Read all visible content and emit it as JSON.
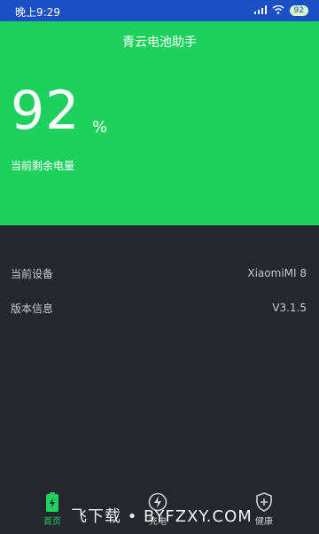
{
  "status_bar": {
    "time": "晚上9:29",
    "battery": "92"
  },
  "app": {
    "title": "青云电池助手"
  },
  "battery": {
    "level": "92",
    "unit": "%",
    "label": "当前剩余电量"
  },
  "info": [
    {
      "label": "当前设备",
      "value": "XiaomiMI 8"
    },
    {
      "label": "版本信息",
      "value": "V3.1.5"
    }
  ],
  "nav": [
    {
      "label": "首页",
      "icon": "battery-icon",
      "active": true
    },
    {
      "label": "充电",
      "icon": "lightning-icon",
      "active": false
    },
    {
      "label": "健康",
      "icon": "shield-plus-icon",
      "active": false
    }
  ],
  "watermark": "飞下载 • BYFZXY.COM",
  "colors": {
    "accent": "#1ed15f",
    "background": "#25262e",
    "statusbar": "#1b4fc4"
  }
}
